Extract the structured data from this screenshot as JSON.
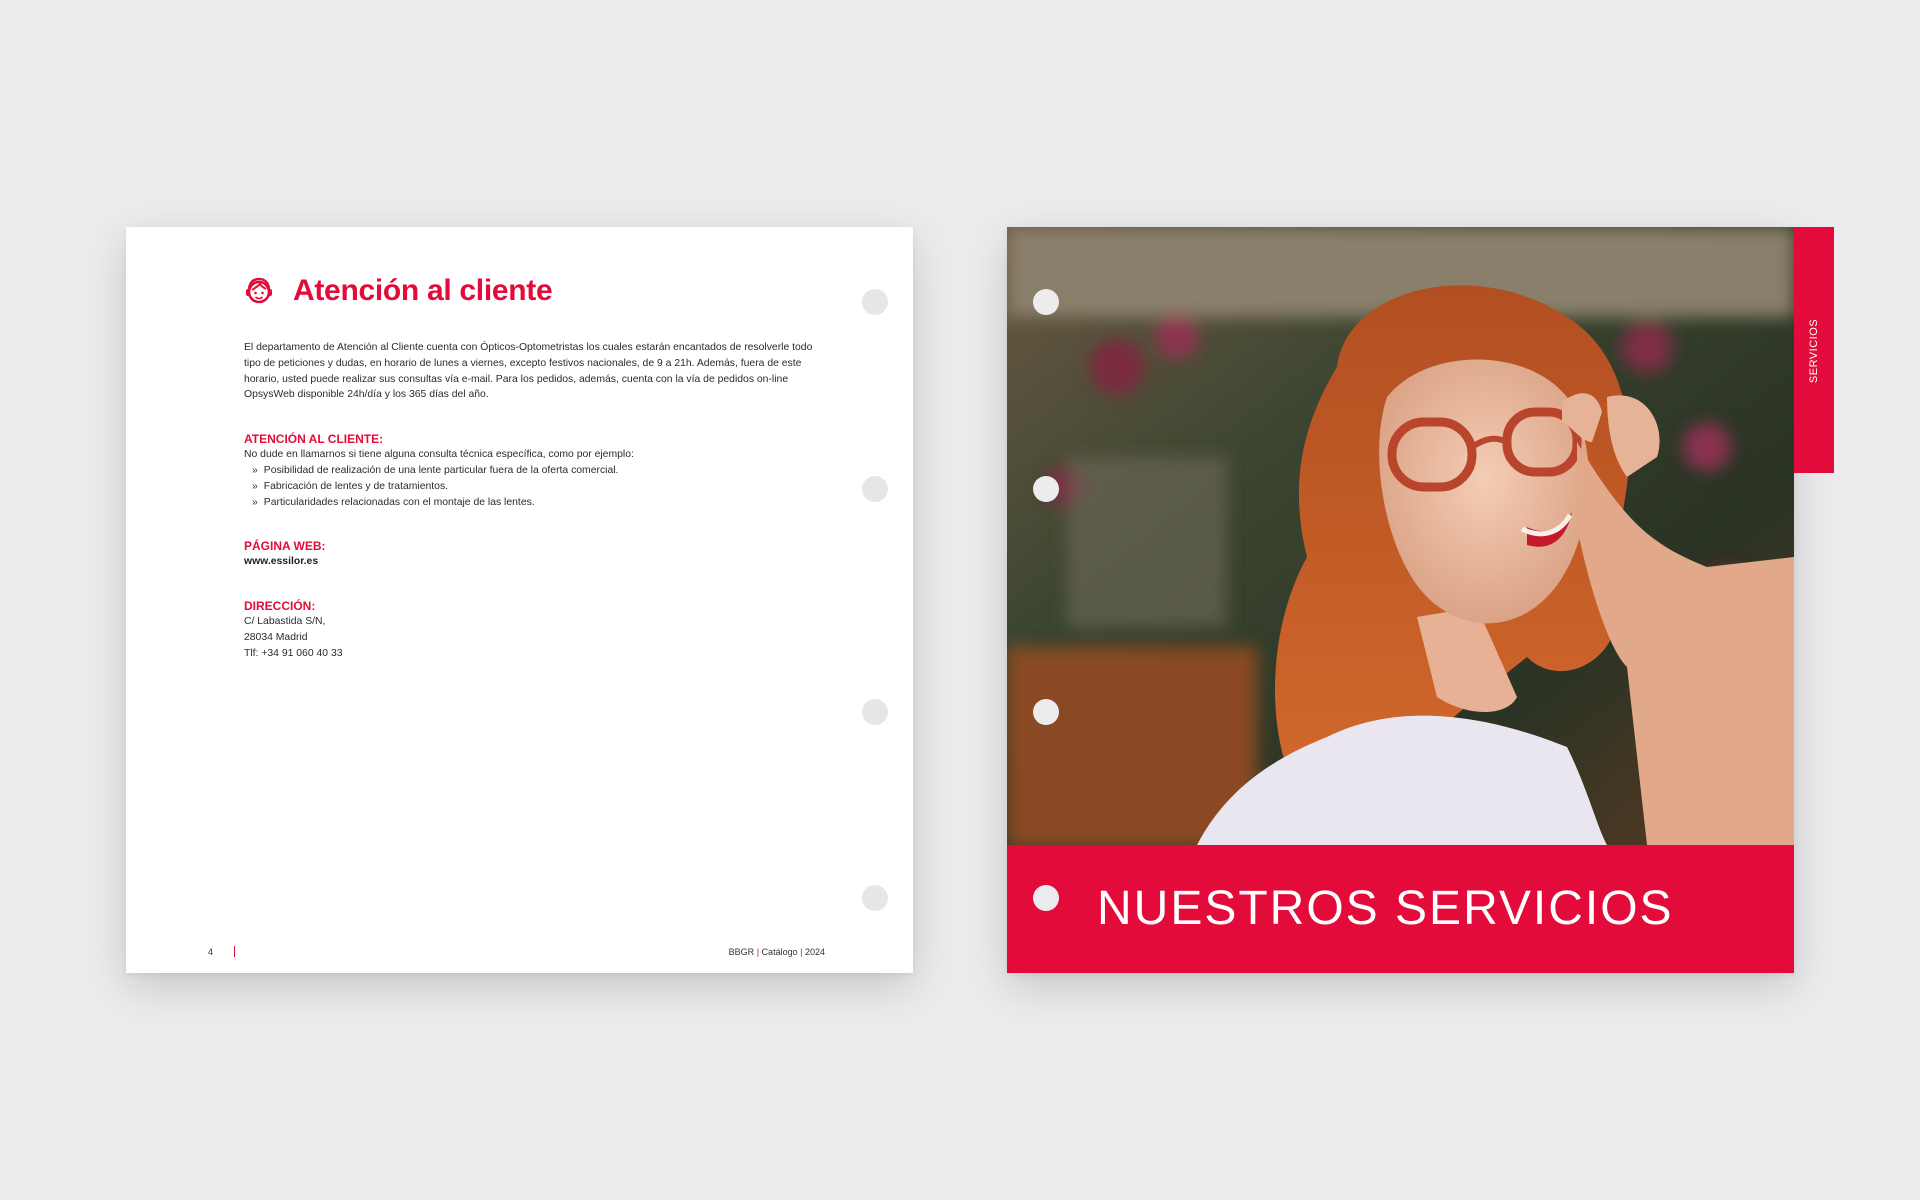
{
  "left_page": {
    "title": "Atención al cliente",
    "title_icon": "headset-agent-icon",
    "intro": "El departamento de Atención al Cliente cuenta con Ópticos-Optometristas los cuales estarán encantados de resolverle todo tipo de peticiones y dudas, en horario de lunes a viernes, excepto festivos nacionales, de 9 a 21h. Además, fuera de este horario, usted puede realizar sus consultas vía e-mail. Para los pedidos, además, cuenta con la vía de pedidos on-line OpsysWeb disponible 24h/día y los 365 días del año.",
    "attention": {
      "heading": "ATENCIÓN AL CLIENTE:",
      "lead": "No dude en llamarnos si tiene alguna consulta técnica específica, como por ejemplo:",
      "bullet_mark": "»",
      "items": [
        "Posibilidad de realización de una lente particular fuera de la oferta comercial.",
        "Fabricación de lentes y de tratamientos.",
        "Particularidades relacionadas con el montaje de las lentes."
      ]
    },
    "web": {
      "heading": "PÁGINA WEB:",
      "url": "www.essilor.es"
    },
    "address": {
      "heading": "DIRECCIÓN:",
      "lines": [
        "C/ Labastida S/N,",
        "28034 Madrid",
        "Tlf: +34 91 060 40 33"
      ]
    },
    "footer": {
      "page_number": "4",
      "brand": "BBGR",
      "doc": "Catálogo",
      "year": "2024",
      "sep": "|"
    }
  },
  "right_page": {
    "banner_title": "NUESTROS SERVICIOS",
    "tab_label": "SERVICIOS",
    "photo_subject": "smiling woman with red hair adjusting tortoiseshell glasses"
  },
  "colors": {
    "accent": "#e30b39",
    "background": "#ececee",
    "text": "#2b2b2b"
  }
}
